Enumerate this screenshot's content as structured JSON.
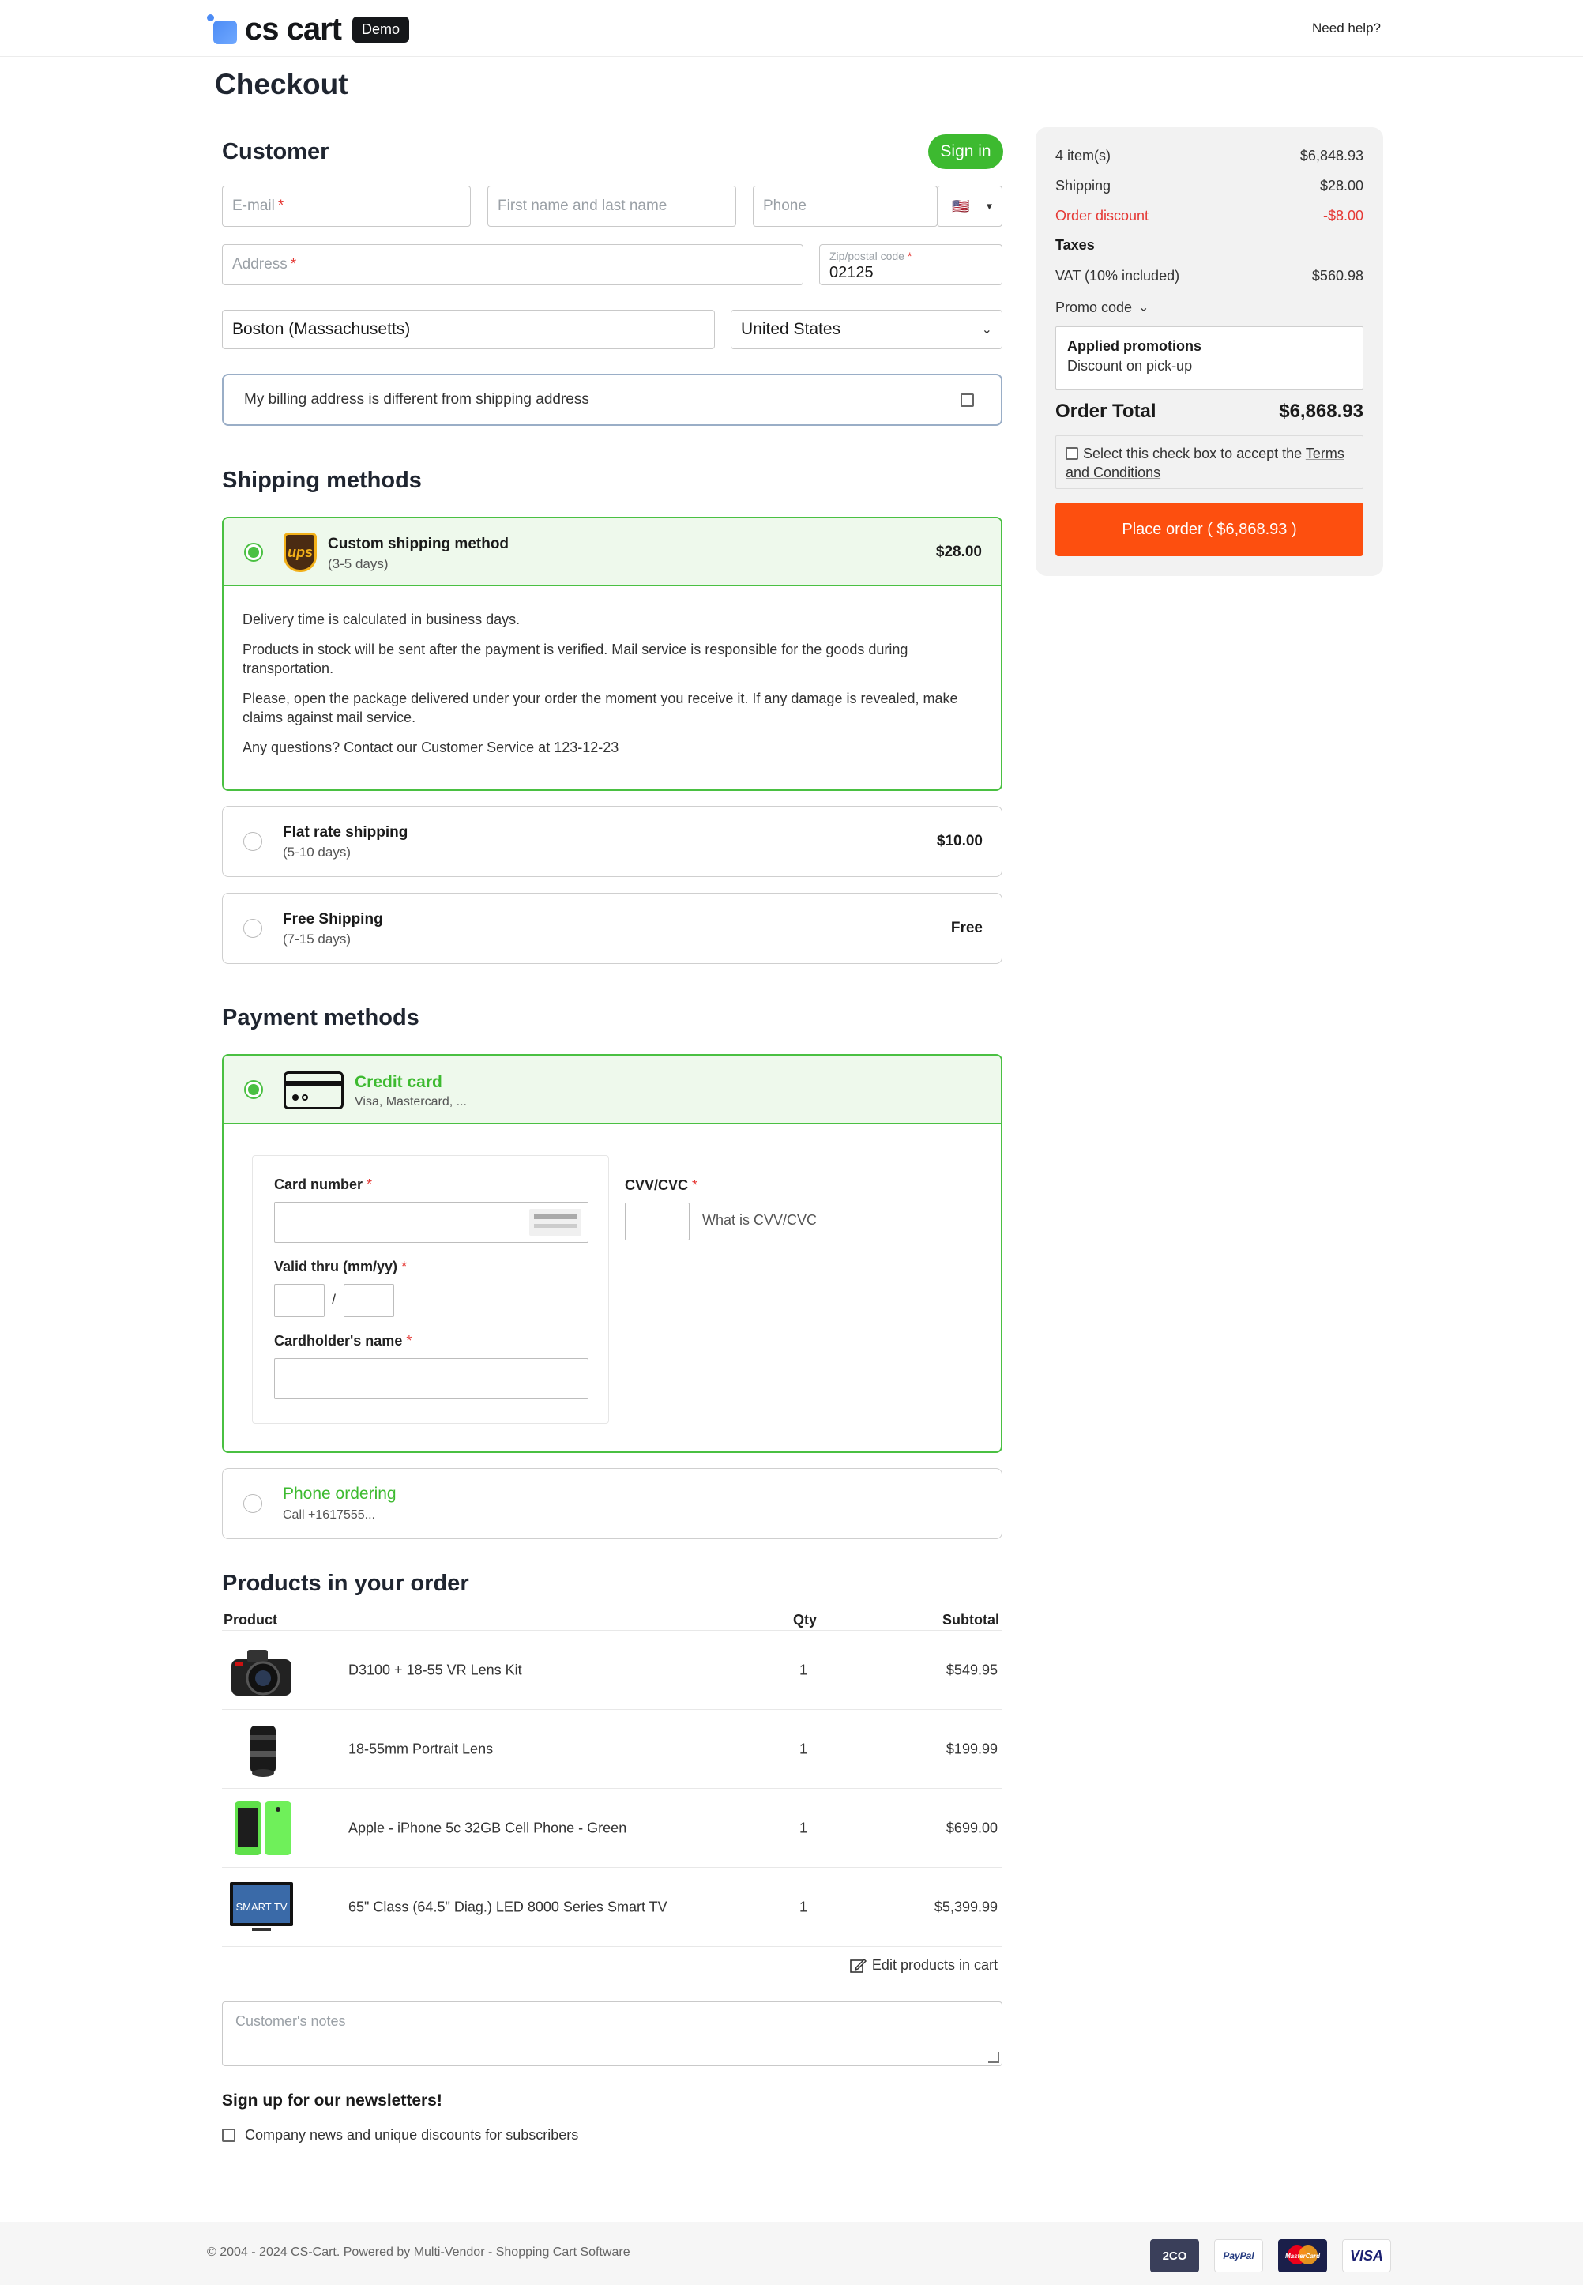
{
  "header": {
    "logo_text": "cs cart",
    "demo_badge": "Demo",
    "need_help": "Need help?"
  },
  "page": {
    "title": "Checkout"
  },
  "customer": {
    "title": "Customer",
    "sign_in": "Sign in",
    "email_placeholder": "E-mail",
    "name_placeholder": "First name and last name",
    "phone_placeholder": "Phone",
    "phone_country_flag": "🇺🇸",
    "address_placeholder": "Address",
    "zip_label": "Zip/postal code",
    "zip_value": "02125",
    "city_value": "Boston (Massachusetts)",
    "country_value": "United States",
    "billing_different": "My billing address is different from shipping address"
  },
  "shipping": {
    "title": "Shipping methods",
    "methods": [
      {
        "name": "Custom shipping method",
        "days": "(3-5 days)",
        "price": "$28.00",
        "selected": true
      },
      {
        "name": "Flat rate shipping",
        "days": "(5-10 days)",
        "price": "$10.00",
        "selected": false
      },
      {
        "name": "Free Shipping",
        "days": "(7-15 days)",
        "price": "Free",
        "selected": false
      }
    ],
    "description": [
      "Delivery time is calculated in business days.",
      "Products in stock will be sent after the payment is verified. Mail service is responsible for the goods during transportation.",
      "Please, open the package delivered under your order the moment you receive it. If any damage is revealed, make claims against mail service.",
      "Any questions? Contact our Customer Service at 123-12-23"
    ],
    "ups_logo_text": "ups"
  },
  "payment": {
    "title": "Payment methods",
    "credit_card": {
      "name": "Credit card",
      "sub": "Visa, Mastercard, ..."
    },
    "card_number_label": "Card number",
    "valid_thru_label": "Valid thru (mm/yy)",
    "date_separator": "/",
    "cardholder_label": "Cardholder's name",
    "cvv_label": "CVV/CVC",
    "cvv_help": "What is CVV/CVC",
    "phone_ordering": {
      "name": "Phone ordering",
      "sub": "Call +1617555..."
    }
  },
  "products": {
    "title": "Products in your order",
    "headers": {
      "product": "Product",
      "qty": "Qty",
      "subtotal": "Subtotal"
    },
    "items": [
      {
        "name": "D3100 + 18-55 VR Lens Kit",
        "qty": "1",
        "subtotal": "$549.95",
        "thumb": "camera-thumbnail"
      },
      {
        "name": "18-55mm Portrait Lens",
        "qty": "1",
        "subtotal": "$199.99",
        "thumb": "lens-thumbnail"
      },
      {
        "name": "Apple - iPhone 5c 32GB Cell Phone - Green",
        "qty": "1",
        "subtotal": "$699.00",
        "thumb": "phone-thumbnail"
      },
      {
        "name": "65\" Class (64.5\" Diag.) LED 8000 Series Smart TV",
        "qty": "1",
        "subtotal": "$5,399.99",
        "thumb": "tv-thumbnail"
      }
    ],
    "tv_thumb_text": "SMART TV",
    "edit_link": "Edit products in cart",
    "notes_placeholder": "Customer's notes"
  },
  "newsletter": {
    "title": "Sign up for our newsletters!",
    "option": "Company news and unique discounts for subscribers"
  },
  "summary": {
    "items_label": "4 item(s)",
    "items_value": "$6,848.93",
    "shipping_label": "Shipping",
    "shipping_value": "$28.00",
    "discount_label": "Order discount",
    "discount_value": "-$8.00",
    "taxes_label": "Taxes",
    "vat_label": "VAT (10% included)",
    "vat_value": "$560.98",
    "promo_label": "Promo code",
    "promotions_title": "Applied promotions",
    "promotions_detail": "Discount on pick-up",
    "total_label": "Order Total",
    "total_value": "$6,868.93",
    "terms_prefix": "Select this check box to accept the",
    "terms_link": "Terms and Conditions",
    "place_order": "Place order ( $6,868.93 )"
  },
  "footer": {
    "copyright": "© 2004 - 2024 CS-Cart.  Powered by Multi-Vendor - Shopping Cart Software",
    "payment_logos": [
      "2CO",
      "PayPal",
      "MasterCard",
      "VISA"
    ]
  },
  "colors": {
    "accent_green": "#3dba30",
    "place_order_orange": "#fd4f0f",
    "discount_red": "#e53935"
  }
}
